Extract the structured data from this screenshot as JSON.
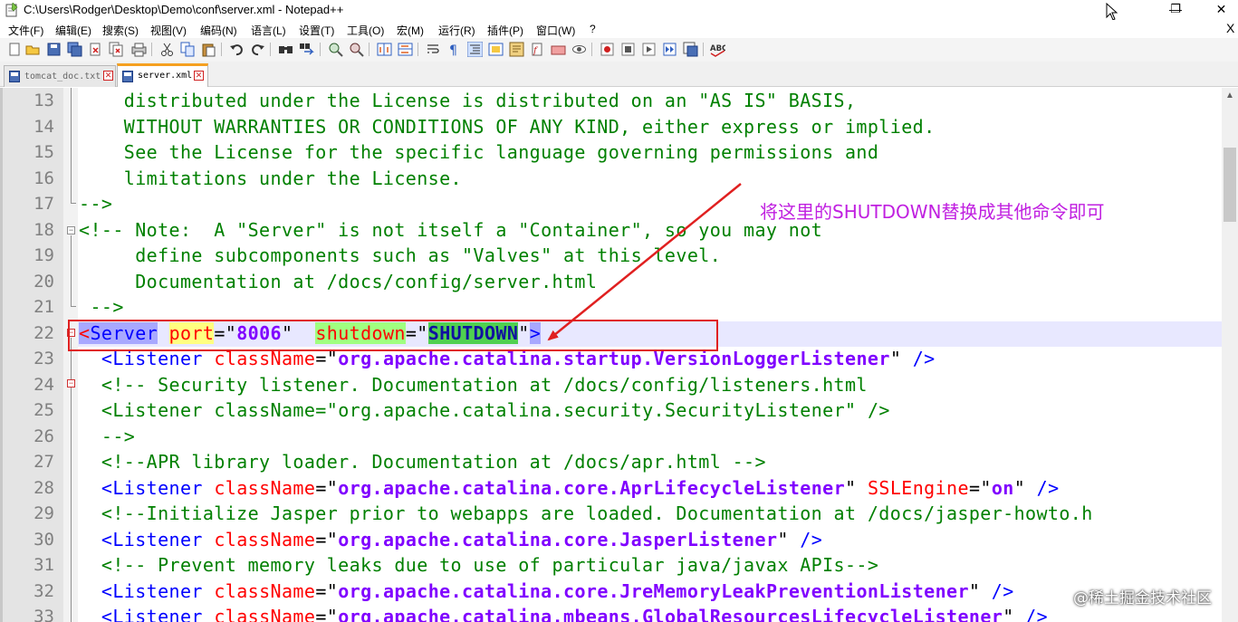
{
  "window": {
    "title": "C:\\Users\\Rodger\\Desktop\\Demo\\conf\\server.xml - Notepad++",
    "min_glyph": "—",
    "max_glyph": "❐",
    "close_glyph": "✕"
  },
  "menu": {
    "items": [
      "文件(F)",
      "编辑(E)",
      "搜索(S)",
      "视图(V)",
      "编码(N)",
      "语言(L)",
      "设置(T)",
      "工具(O)",
      "宏(M)",
      "运行(R)",
      "插件(P)",
      "窗口(W)",
      "?"
    ],
    "close_doc": "X"
  },
  "toolbar": {
    "icons": [
      "new-file-icon",
      "open-file-icon",
      "save-icon",
      "save-all-icon",
      "close-icon",
      "close-all-icon",
      "print-icon",
      "cut-icon",
      "copy-icon",
      "paste-icon",
      "undo-icon",
      "redo-icon",
      "find-icon",
      "replace-icon",
      "zoom-in-icon",
      "zoom-out-icon",
      "sync-vertical-icon",
      "sync-horizontal-icon",
      "word-wrap-icon",
      "show-all-chars-icon",
      "indent-guide-icon",
      "user-lang-icon",
      "doc-map-icon",
      "function-list-icon",
      "folder-workspace-icon",
      "monitor-icon",
      "record-macro-icon",
      "stop-record-icon",
      "play-macro-icon",
      "run-macro-multiple-icon",
      "save-macro-icon",
      "spell-check-icon"
    ],
    "spell_label": "ABC"
  },
  "tabs": [
    {
      "label": "tomcat_doc.txt",
      "active": false
    },
    {
      "label": "server.xml",
      "active": true
    }
  ],
  "editor": {
    "lines": [
      {
        "n": "13",
        "text": "    distributed under the License is distributed on an \"AS IS\" BASIS,"
      },
      {
        "n": "14",
        "text": "    WITHOUT WARRANTIES OR CONDITIONS OF ANY KIND, either express or implied."
      },
      {
        "n": "15",
        "text": "    See the License for the specific language governing permissions and"
      },
      {
        "n": "16",
        "text": "    limitations under the License."
      },
      {
        "n": "17",
        "text": "-->"
      },
      {
        "n": "18",
        "text": "<!-- Note:  A \"Server\" is not itself a \"Container\", so you may not"
      },
      {
        "n": "19",
        "text": "     define subcomponents such as \"Valves\" at this level."
      },
      {
        "n": "20",
        "text": "     Documentation at /docs/config/server.html"
      },
      {
        "n": "21",
        "text": " -->"
      },
      {
        "n": "22",
        "text": ""
      },
      {
        "n": "23",
        "text": ""
      },
      {
        "n": "24",
        "text": "  <!-- Security listener. Documentation at /docs/config/listeners.html"
      },
      {
        "n": "25",
        "text": ""
      },
      {
        "n": "26",
        "text": "  -->"
      },
      {
        "n": "27",
        "text": "  <!--APR library loader. Documentation at /docs/apr.html -->"
      },
      {
        "n": "28",
        "text": ""
      },
      {
        "n": "29",
        "text": "  <!--Initialize Jasper prior to webapps are loaded. Documentation at /docs/jasper-howto.h"
      },
      {
        "n": "30",
        "text": ""
      },
      {
        "n": "31",
        "text": "  <!-- Prevent memory leaks due to use of particular java/javax APIs-->"
      },
      {
        "n": "32",
        "text": ""
      },
      {
        "n": "33",
        "text": ""
      }
    ],
    "server_line": {
      "lt": "<",
      "tag": "Server",
      "port_attr": "port",
      "port_val": "8006",
      "shutdown_attr": "shutdown",
      "shutdown_val": "SHUTDOWN",
      "close": ">"
    },
    "listener_23": {
      "tag": "Listener",
      "attr": "className",
      "val": "org.apache.catalina.startup.VersionLoggerListener",
      "end": " />"
    },
    "listener_25": {
      "tag": "Listener",
      "attr": "className",
      "val": "org.apache.catalina.security.SecurityListener",
      "end": " />"
    },
    "listener_28": {
      "tag": "Listener",
      "attr": "className",
      "val": "org.apache.catalina.core.AprLifecycleListener",
      "attr2": "SSLEngine",
      "val2": "on",
      "end": " />"
    },
    "listener_30": {
      "tag": "Listener",
      "attr": "className",
      "val": "org.apache.catalina.core.JasperListener",
      "end": " />"
    },
    "listener_32": {
      "tag": "Listener",
      "attr": "className",
      "val": "org.apache.catalina.core.JreMemoryLeakPreventionListener",
      "end": " />"
    },
    "listener_33": {
      "tag": "Listener",
      "attr": "className",
      "val": "org.apache.catalina.mbeans.GlobalResourcesLifecycleListener",
      "end": " />"
    }
  },
  "annotation": {
    "text": "将这里的SHUTDOWN替换成其他命令即可",
    "color": "#c020e0",
    "box_color": "#e02020"
  },
  "watermark": "@稀土掘金技术社区"
}
